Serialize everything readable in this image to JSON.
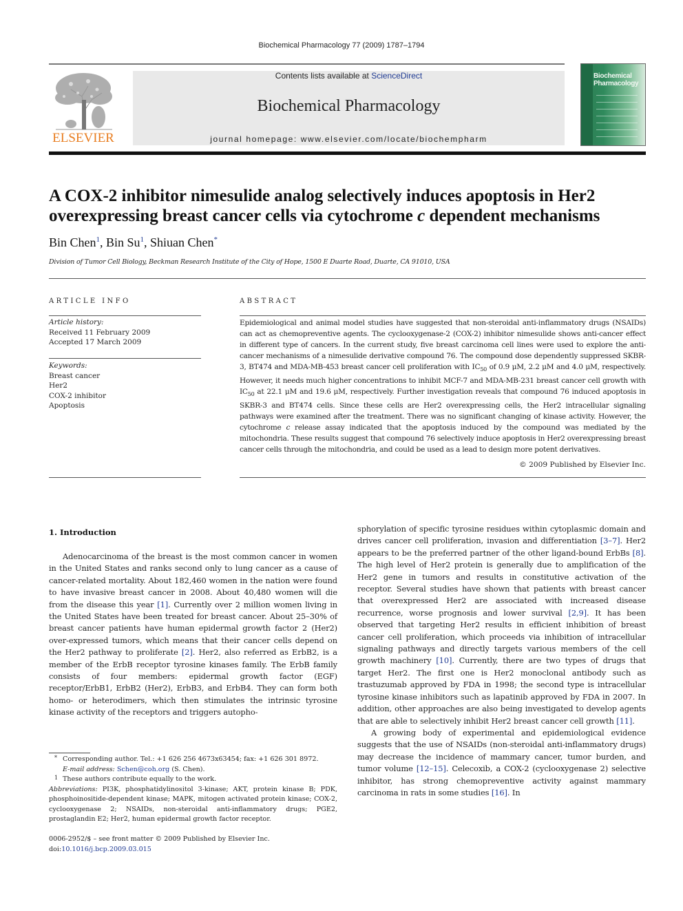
{
  "running_head": "Biochemical Pharmacology 77 (2009) 1787–1794",
  "masthead": {
    "publisher": "ELSEVIER",
    "contents_prefix": "Contents lists available at ",
    "contents_link": "ScienceDirect",
    "journal_title": "Biochemical Pharmacology",
    "homepage": "journal homepage: www.elsevier.com/locate/biochempharm",
    "cover_title_line1": "Biochemical",
    "cover_title_line2": "Pharmacology",
    "brand_color": "#e87c1e",
    "cover_color": "#2f8a5c"
  },
  "article": {
    "title_part1": "A COX-2 inhibitor nimesulide analog selectively induces apoptosis in Her2 overexpressing breast cancer cells via cytochrome ",
    "title_italic": "c",
    "title_part2": " dependent mechanisms",
    "authors": [
      {
        "name": "Bin Chen",
        "mark": "1"
      },
      {
        "name": "Bin Su",
        "mark": "1"
      },
      {
        "name": "Shiuan Chen",
        "mark": "*"
      }
    ],
    "affiliation": "Division of Tumor Cell Biology, Beckman Research Institute of the City of Hope, 1500 E Duarte Road, Duarte, CA 91010, USA"
  },
  "article_info": {
    "heading": "ARTICLE INFO",
    "history_label": "Article history:",
    "received": "Received 11 February 2009",
    "accepted": "Accepted 17 March 2009",
    "keywords_label": "Keywords:",
    "keywords": [
      "Breast cancer",
      "Her2",
      "COX-2 inhibitor",
      "Apoptosis"
    ]
  },
  "abstract": {
    "heading": "ABSTRACT",
    "p1": "Epidemiological and animal model studies have suggested that non-steroidal anti-inflammatory drugs (NSAIDs) can act as chemopreventive agents. The cyclooxygenase-2 (COX-2) inhibitor nimesulide shows anti-cancer effect in different type of cancers. In the current study, five breast carcinoma cell lines were used to explore the anti-cancer mechanisms of a nimesulide derivative compound 76. The compound dose dependently suppressed SKBR-3, BT474 and MDA-MB-453 breast cancer cell proliferation with IC",
    "sub1": "50",
    "p2": " of 0.9 μM, 2.2 μM and 4.0 μM, respectively. However, it needs much higher concentrations to inhibit MCF-7 and MDA-MB-231 breast cancer cell growth with IC",
    "sub2": "50",
    "p3": " at 22.1 μM and 19.6 μM, respectively. Further investigation reveals that compound 76 induced apoptosis in SKBR-3 and BT474 cells. Since these cells are Her2 overexpressing cells, the Her2 intracellular signaling pathways were examined after the treatment. There was no significant changing of kinase activity. However, the cytochrome ",
    "italic_c": "c",
    "p4": " release assay indicated that the apoptosis induced by the compound was mediated by the mitochondria. These results suggest that compound 76 selectively induce apoptosis in Her2 overexpressing breast cancer cells through the mitochondria, and could be used as a lead to design more potent derivatives.",
    "copyright": "© 2009 Published by Elsevier Inc."
  },
  "introduction": {
    "heading": "1.  Introduction",
    "left": {
      "t1": "Adenocarcinoma of the breast is the most common cancer in women in the United States and ranks second only to lung cancer as a cause of cancer-related mortality. About 182,460 women in the nation were found to have invasive breast cancer in 2008. About 40,480 women will die from the disease this year ",
      "r1": "[1]",
      "t2": ". Currently over 2 million women living in the United States have been treated for breast cancer. About 25–30% of breast cancer patients have human epidermal growth factor 2 (Her2) over-expressed tumors, which means that their cancer cells depend on the Her2 pathway to proliferate ",
      "r2": "[2]",
      "t3": ". Her2, also referred as ErbB2, is a member of the ErbB receptor tyrosine kinases family. The ErbB family consists of four members: epidermal growth factor (EGF) receptor/ErbB1, ErbB2 (Her2), ErbB3, and ErbB4. They can form both homo- or heterodimers, which then stimulates the intrinsic tyrosine kinase activity of the receptors and triggers autopho-"
    },
    "right": {
      "t1": "sphorylation of specific tyrosine residues within cytoplasmic domain and drives cancer cell proliferation, invasion and differentiation ",
      "r1": "[3–7]",
      "t2": ". Her2 appears to be the preferred partner of the other ligand-bound ErbBs ",
      "r2": "[8]",
      "t3": ". The high level of Her2 protein is generally due to amplification of the Her2 gene in tumors and results in constitutive activation of the receptor. Several studies have shown that patients with breast cancer that overexpressed Her2 are associated with increased disease recurrence, worse prognosis and lower survival ",
      "r3": "[2,9]",
      "t4": ". It has been observed that targeting Her2 results in efficient inhibition of breast cancer cell proliferation, which proceeds via inhibition of intracellular signaling pathways and directly targets various members of the cell growth machinery ",
      "r4": "[10]",
      "t5": ". Currently, there are two types of drugs that target Her2. The first one is Her2 monoclonal antibody such as trastuzumab approved by FDA in 1998; the second type is intracellular tyrosine kinase inhibitors such as lapatinib approved by FDA in 2007. In addition, other approaches are also being investigated to develop agents that are able to selectively inhibit Her2 breast cancer cell growth ",
      "r5": "[11]",
      "t6": ".",
      "p2_t1": "A growing body of experimental and epidemiological evidence suggests that the use of NSAIDs (non-steroidal anti-inflammatory drugs) may decrease the incidence of mammary cancer, tumor burden, and tumor volume ",
      "p2_r1": "[12–15]",
      "p2_t2": ". Celecoxib, a COX-2 (cyclooxygenase 2) selective inhibitor, has strong chemopreventive activity against mammary carcinoma in rats in some studies ",
      "p2_r2": "[16]",
      "p2_t3": ". In"
    }
  },
  "footnotes": {
    "corr_mark": "*",
    "corr_text": "Corresponding author. Tel.: +1 626 256 4673x63454; fax: +1 626 301 8972.",
    "email_label": "E-mail address:",
    "email": "Schen@coh.org",
    "email_suffix": " (S. Chen).",
    "equal_mark": "1",
    "equal_text": "These authors contribute equally to the work.",
    "abbr_label": "Abbreviations:",
    "abbr_text": " PI3K, phosphatidylinositol 3-kinase; AKT, protein kinase B; PDK, phosphoinositide-dependent kinase; MAPK, mitogen activated protein kinase; COX-2, cyclooxygenase 2; NSAIDs, non-steroidal anti-inflammatory drugs; PGE2, prostaglandin E2; Her2, human epidermal growth factor receptor."
  },
  "front_matter": {
    "issn_line": "0006-2952/$ – see front matter © 2009 Published by Elsevier Inc.",
    "doi_prefix": "doi:",
    "doi": "10.1016/j.bcp.2009.03.015"
  }
}
